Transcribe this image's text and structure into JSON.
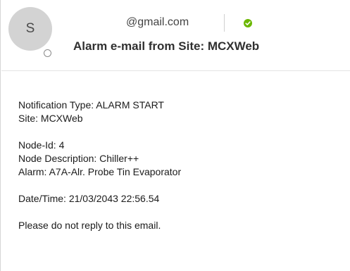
{
  "header": {
    "avatar_initial": "S",
    "sender_email": "@gmail.com",
    "subject": "Alarm e-mail from Site: MCXWeb",
    "verified_icon": "check-circle-icon",
    "verified_color": "#6bb700"
  },
  "message": {
    "notification_type": "Notification Type: ALARM START",
    "site": "Site: MCXWeb",
    "node_id": "Node-Id: 4",
    "node_description": "Node Description: Chiller++",
    "alarm": "Alarm: A7A-Alr. Probe Tin Evaporator",
    "datetime": "Date/Time: 21/03/2043 22:56.54",
    "footer": "Please do not reply to this email."
  }
}
